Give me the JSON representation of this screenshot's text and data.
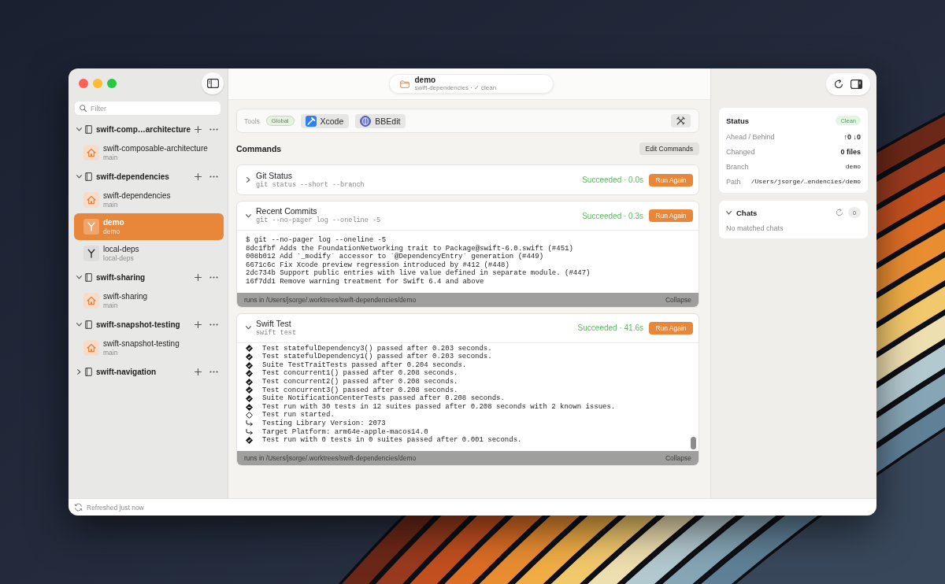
{
  "sidebar": {
    "filter": {
      "placeholder": "Filter"
    },
    "groups": [
      {
        "name": "swift-comp…architecture",
        "expanded": true,
        "items": [
          {
            "title": "swift-composable-architecture",
            "branch": "main",
            "kind": "main",
            "selected": false
          }
        ]
      },
      {
        "name": "swift-dependencies",
        "expanded": true,
        "items": [
          {
            "title": "swift-dependencies",
            "branch": "main",
            "kind": "main",
            "selected": false
          },
          {
            "title": "demo",
            "branch": "demo",
            "kind": "worktree",
            "selected": true
          },
          {
            "title": "local-deps",
            "branch": "local-deps",
            "kind": "worktree",
            "selected": false
          }
        ]
      },
      {
        "name": "swift-sharing",
        "expanded": true,
        "items": [
          {
            "title": "swift-sharing",
            "branch": "main",
            "kind": "main",
            "selected": false
          }
        ]
      },
      {
        "name": "swift-snapshot-testing",
        "expanded": true,
        "items": [
          {
            "title": "swift-snapshot-testing",
            "branch": "main",
            "kind": "main",
            "selected": false
          }
        ]
      },
      {
        "name": "swift-navigation",
        "expanded": false
      }
    ]
  },
  "header": {
    "title": "demo",
    "subtitle": "swift-dependencies · ✓ clean"
  },
  "tools": {
    "label": "Tools",
    "scope": "Global",
    "apps": [
      {
        "name": "Xcode",
        "kind": "xcode"
      },
      {
        "name": "BBEdit",
        "kind": "bbedit"
      }
    ]
  },
  "commands": {
    "title": "Commands",
    "edit_button": "Edit Commands",
    "items": [
      {
        "name": "Git Status",
        "command": "git status --short --branch",
        "result": "Succeeded · 0.0s",
        "action": "Run Again",
        "expanded": false
      },
      {
        "name": "Recent Commits",
        "command": "git --no-pager log --oneline -5",
        "result": "Succeeded · 0.3s",
        "action": "Run Again",
        "expanded": true,
        "lines": [
          {
            "kind": "plain",
            "text": "$ git --no-pager log --oneline -5"
          },
          {
            "kind": "plain",
            "text": "8dc1fbf Adds the FoundationNetworking trait to Package@swift-6.0.swift (#451)"
          },
          {
            "kind": "plain",
            "text": "008b012 Add `_modify` accessor to `@DependencyEntry` generation (#449)"
          },
          {
            "kind": "plain",
            "text": "6671c6c Fix Xcode preview regression introduced by #412 (#448)"
          },
          {
            "kind": "plain",
            "text": "2dc734b Support public entries with live value defined in separate module. (#447)"
          },
          {
            "kind": "plain",
            "text": "16f7dd1 Remove warning treatment for Swift 6.4 and above"
          }
        ],
        "directory": "runs in /Users/jsorge/.worktrees/swift-dependencies/demo",
        "collapse": "Collapse"
      },
      {
        "name": "Swift Test",
        "command": "swift test",
        "result": "Succeeded · 41.6s",
        "action": "Run Again",
        "expanded": true,
        "lines": [
          {
            "kind": "passed",
            "text": "Test statefulDependency3() passed after 0.203 seconds."
          },
          {
            "kind": "passed",
            "text": "Test statefulDependency1() passed after 0.203 seconds."
          },
          {
            "kind": "passed",
            "text": "Suite TestTraitTests passed after 0.204 seconds."
          },
          {
            "kind": "passed",
            "text": "Test concurrent1() passed after 0.208 seconds."
          },
          {
            "kind": "passed",
            "text": "Test concurrent2() passed after 0.208 seconds."
          },
          {
            "kind": "passed",
            "text": "Test concurrent3() passed after 0.208 seconds."
          },
          {
            "kind": "passed",
            "text": "Suite NotificationCenterTests passed after 0.208 seconds."
          },
          {
            "kind": "issues",
            "text": "Test run with 30 tests in 12 suites passed after 0.208 seconds with 2 known issues."
          },
          {
            "kind": "started",
            "text": "Test run started."
          },
          {
            "kind": "info",
            "text": "Testing Library Version: 2073"
          },
          {
            "kind": "info",
            "text": "Target Platform: arm64e-apple-macos14.0"
          },
          {
            "kind": "passed",
            "text": "Test run with 0 tests in 0 suites passed after 0.001 seconds."
          }
        ],
        "directory": "runs in /Users/jsorge/.worktrees/swift-dependencies/demo",
        "collapse": "Collapse"
      }
    ]
  },
  "inspector": {
    "status": {
      "title": "Status",
      "badge": "Clean",
      "rows": [
        {
          "label": "Ahead / Behind",
          "value": "↑0 ↓0",
          "kind": "text"
        },
        {
          "label": "Changed",
          "value": "0 files",
          "kind": "text"
        },
        {
          "label": "Branch",
          "value": "demo",
          "kind": "mono"
        },
        {
          "label": "Path",
          "value": "/Users/jsorge/…endencies/demo",
          "kind": "mono"
        }
      ]
    },
    "chats": {
      "title": "Chats",
      "expanded": true,
      "count": "0",
      "empty": "No matched chats"
    }
  },
  "status_bar": {
    "text": "Refreshed just now"
  }
}
